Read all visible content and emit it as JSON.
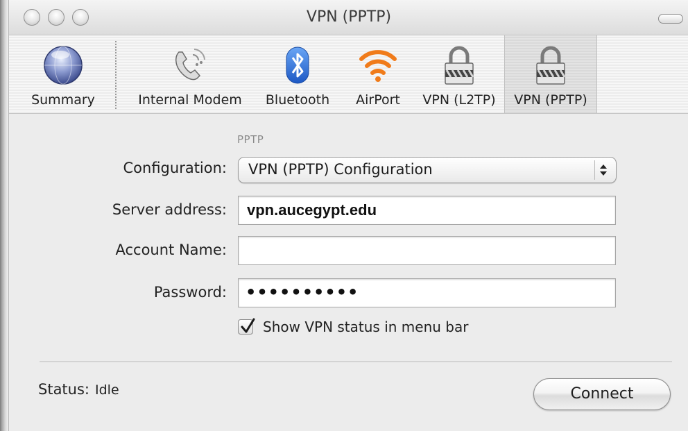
{
  "window": {
    "title": "VPN (PPTP)"
  },
  "toolbar": {
    "items": [
      {
        "label": "Summary",
        "icon": "globe-icon"
      },
      {
        "label": "Internal Modem",
        "icon": "phone-modem-icon"
      },
      {
        "label": "Bluetooth",
        "icon": "bluetooth-icon"
      },
      {
        "label": "AirPort",
        "icon": "wifi-icon"
      },
      {
        "label": "VPN (L2TP)",
        "icon": "lock-icon"
      },
      {
        "label": "VPN (PPTP)",
        "icon": "lock-icon",
        "selected": true
      }
    ]
  },
  "form": {
    "section_label": "PPTP",
    "configuration": {
      "label": "Configuration:",
      "value": "VPN (PPTP) Configuration"
    },
    "server_address": {
      "label": "Server address:",
      "value": "vpn.aucegypt.edu"
    },
    "account_name": {
      "label": "Account Name:",
      "value": ""
    },
    "password": {
      "label": "Password:",
      "value": "••••••••••"
    },
    "show_status": {
      "label": "Show VPN status in menu bar",
      "checked": true
    }
  },
  "footer": {
    "status_label": "Status:",
    "status_value": "Idle",
    "connect_label": "Connect"
  },
  "colors": {
    "airport_orange": "#f07b1a",
    "bluetooth_blue": "#2a6fd6"
  }
}
